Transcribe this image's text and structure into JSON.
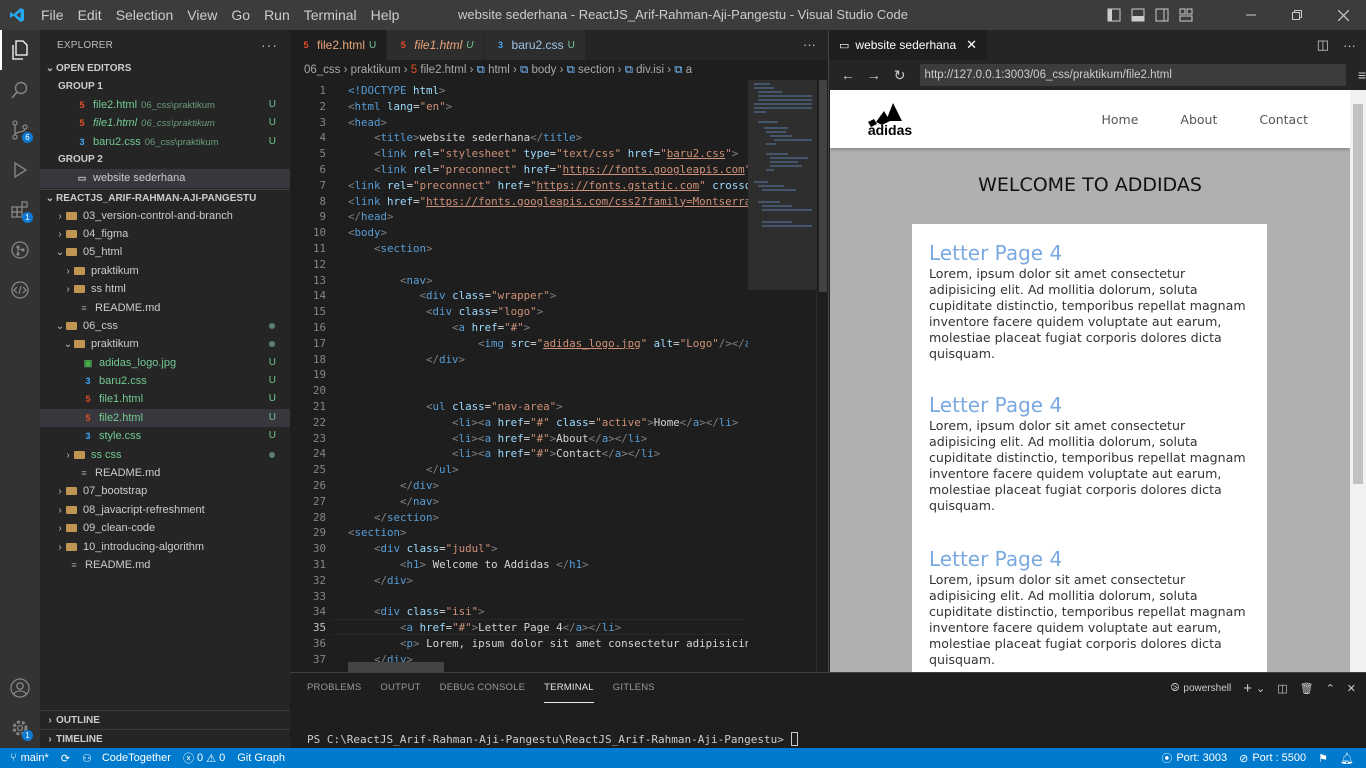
{
  "window": {
    "title": "website sederhana - ReactJS_Arif-Rahman-Aji-Pangestu - Visual Studio Code",
    "menu": [
      "File",
      "Edit",
      "Selection",
      "View",
      "Go",
      "Run",
      "Terminal",
      "Help"
    ]
  },
  "activity": {
    "source_control_badge": "6",
    "extensions_badge": "1",
    "accounts_badge": "1"
  },
  "sidebar": {
    "title": "EXPLORER",
    "open_editors": "OPEN EDITORS",
    "group1": "GROUP 1",
    "group1_items": [
      {
        "name": "file2.html",
        "path": "06_css\\praktikum",
        "status": "U"
      },
      {
        "name": "file1.html",
        "path": "06_css\\praktikum",
        "status": "U"
      },
      {
        "name": "baru2.css",
        "path": "06_css\\praktikum",
        "status": "U"
      }
    ],
    "group2": "GROUP 2",
    "group2_item": "website sederhana",
    "project": "REACTJS_ARIF-RAHMAN-AJI-PANGESTU",
    "tree": [
      {
        "label": "03_version-control-and-branch"
      },
      {
        "label": "04_figma"
      },
      {
        "label": "05_html"
      },
      {
        "label": "praktikum"
      },
      {
        "label": "ss html"
      },
      {
        "label": "README.md"
      },
      {
        "label": "06_css"
      },
      {
        "label": "praktikum"
      },
      {
        "label": "adidas_logo.jpg",
        "status": "U"
      },
      {
        "label": "baru2.css",
        "status": "U"
      },
      {
        "label": "file1.html",
        "status": "U"
      },
      {
        "label": "file2.html",
        "status": "U"
      },
      {
        "label": "style.css",
        "status": "U"
      },
      {
        "label": "ss css"
      },
      {
        "label": "README.md"
      },
      {
        "label": "07_bootstrap"
      },
      {
        "label": "08_javacript-refreshment"
      },
      {
        "label": "09_clean-code"
      },
      {
        "label": "10_introducing-algorithm"
      },
      {
        "label": "README.md"
      }
    ],
    "outline": "OUTLINE",
    "timeline": "TIMELINE"
  },
  "editor": {
    "tabs": [
      {
        "name": "file2.html",
        "status": "U"
      },
      {
        "name": "file1.html",
        "status": "U"
      },
      {
        "name": "baru2.css",
        "status": "U"
      }
    ],
    "breadcrumbs": [
      "06_css",
      "praktikum",
      "file2.html",
      "html",
      "body",
      "section",
      "div.isi",
      "a"
    ],
    "current_line": "35",
    "line_numbers": [
      "1",
      "2",
      "3",
      "4",
      "5",
      "6",
      "7",
      "8",
      "9",
      "10",
      "11",
      "12",
      "13",
      "14",
      "15",
      "16",
      "17",
      "18",
      "19",
      "20",
      "21",
      "22",
      "23",
      "24",
      "25",
      "26",
      "27",
      "28",
      "29",
      "30",
      "31",
      "32",
      "33",
      "34",
      "35",
      "36",
      "37"
    ]
  },
  "preview": {
    "tab": "website sederhana",
    "url": "http://127.0.0.1:3003/06_css/praktikum/file2.html",
    "logo_text": "adidas",
    "nav": [
      "Home",
      "About",
      "Contact"
    ],
    "heading": "WELCOME TO ADDIDAS",
    "items": [
      {
        "title": "Letter Page 4",
        "text": "Lorem, ipsum dolor sit amet consectetur adipisicing elit. Ad mollitia dolorum, soluta cupiditate distinctio, temporibus repellat magnam inventore facere quidem voluptate aut earum, molestiae placeat fugiat corporis dolores dicta quisquam."
      },
      {
        "title": "Letter Page 4",
        "text": "Lorem, ipsum dolor sit amet consectetur adipisicing elit. Ad mollitia dolorum, soluta cupiditate distinctio, temporibus repellat magnam inventore facere quidem voluptate aut earum, molestiae placeat fugiat corporis dolores dicta quisquam."
      },
      {
        "title": "Letter Page 4",
        "text": "Lorem, ipsum dolor sit amet consectetur adipisicing elit. Ad mollitia dolorum, soluta cupiditate distinctio, temporibus repellat magnam inventore facere quidem voluptate aut earum, molestiae placeat fugiat corporis dolores dicta quisquam."
      }
    ]
  },
  "panel": {
    "tabs": [
      "PROBLEMS",
      "OUTPUT",
      "DEBUG CONSOLE",
      "TERMINAL",
      "GITLENS"
    ],
    "active_tab": "TERMINAL",
    "shell": "powershell",
    "prompt": "PS C:\\ReactJS_Arif-Rahman-Aji-Pangestu\\ReactJS_Arif-Rahman-Aji-Pangestu>"
  },
  "status": {
    "branch": "main*",
    "codetogether": "CodeTogether",
    "errors": "0",
    "warnings": "0",
    "gitgraph": "Git Graph",
    "port1": "Port: 3003",
    "port2": "Port : 5500"
  }
}
